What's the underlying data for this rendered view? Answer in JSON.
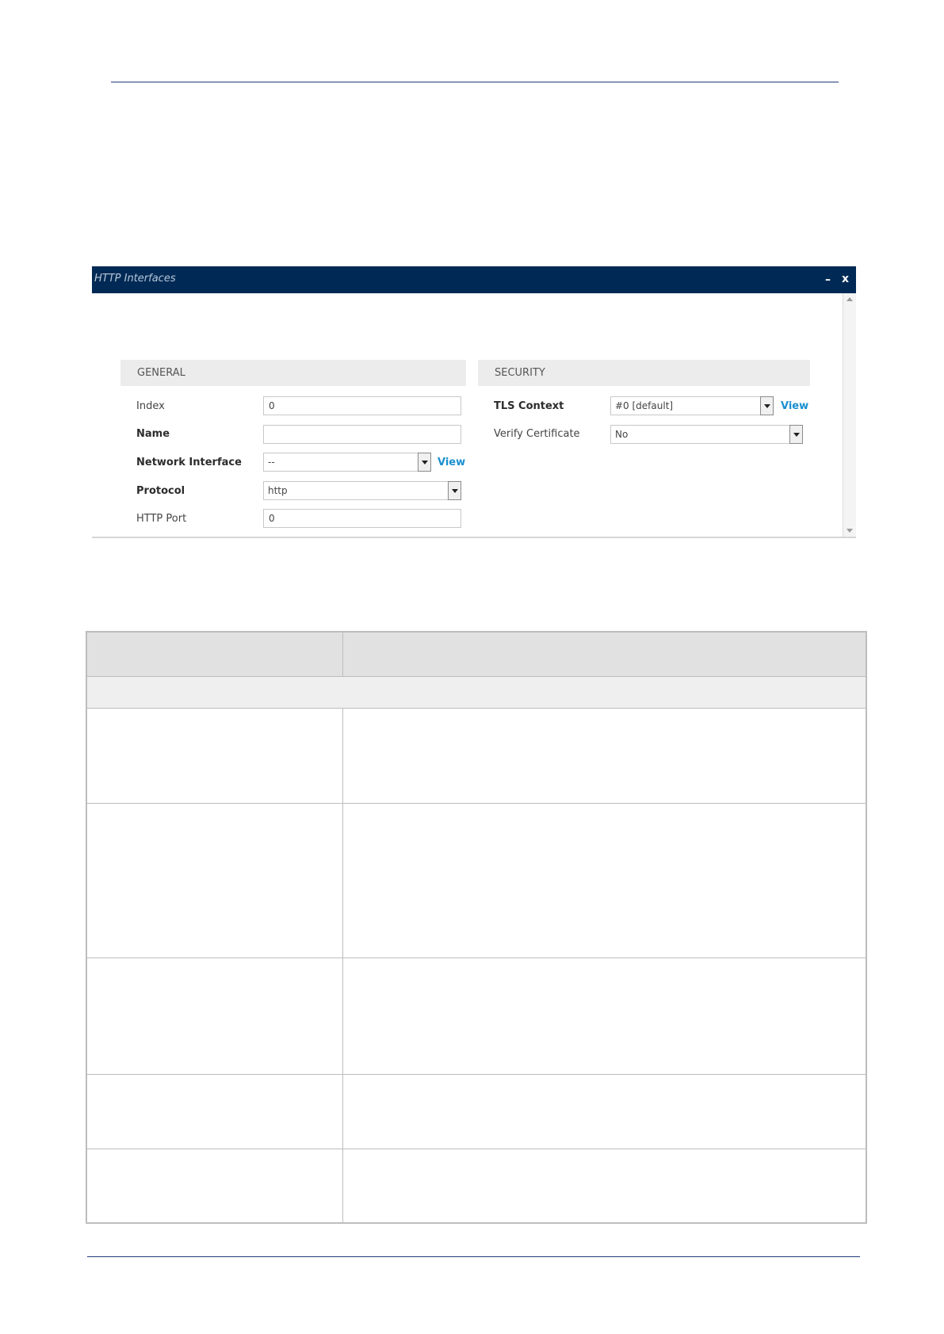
{
  "dialog": {
    "title": "HTTP Interfaces",
    "minimize_glyph": "–",
    "close_glyph": "x",
    "general": {
      "header": "GENERAL",
      "fields": [
        {
          "label": "Index",
          "value": "0",
          "type": "text",
          "bold": false
        },
        {
          "label": "Name",
          "value": "",
          "type": "text",
          "bold": true
        },
        {
          "label": "Network Interface",
          "value": "--",
          "type": "select",
          "bold": true,
          "link": "View"
        },
        {
          "label": "Protocol",
          "value": "http",
          "type": "select",
          "bold": true
        },
        {
          "label": "HTTP Port",
          "value": "0",
          "type": "text",
          "bold": false
        }
      ]
    },
    "security": {
      "header": "SECURITY",
      "fields": [
        {
          "label": "TLS Context",
          "value": "#0 [default]",
          "type": "select",
          "bold": true,
          "link": "View"
        },
        {
          "label": "Verify Certificate",
          "value": "No",
          "type": "select",
          "bold": false
        }
      ]
    }
  },
  "colors": {
    "titlebar": "#002a55",
    "link": "#1a8fcf",
    "section_header_bg": "#ececec",
    "table_header_bg": "#e1e1e1"
  },
  "table": {
    "header": [
      "",
      ""
    ],
    "group_row": "",
    "rows": [
      [
        "",
        ""
      ],
      [
        "",
        ""
      ],
      [
        "",
        ""
      ],
      [
        "",
        ""
      ],
      [
        "",
        ""
      ]
    ]
  }
}
